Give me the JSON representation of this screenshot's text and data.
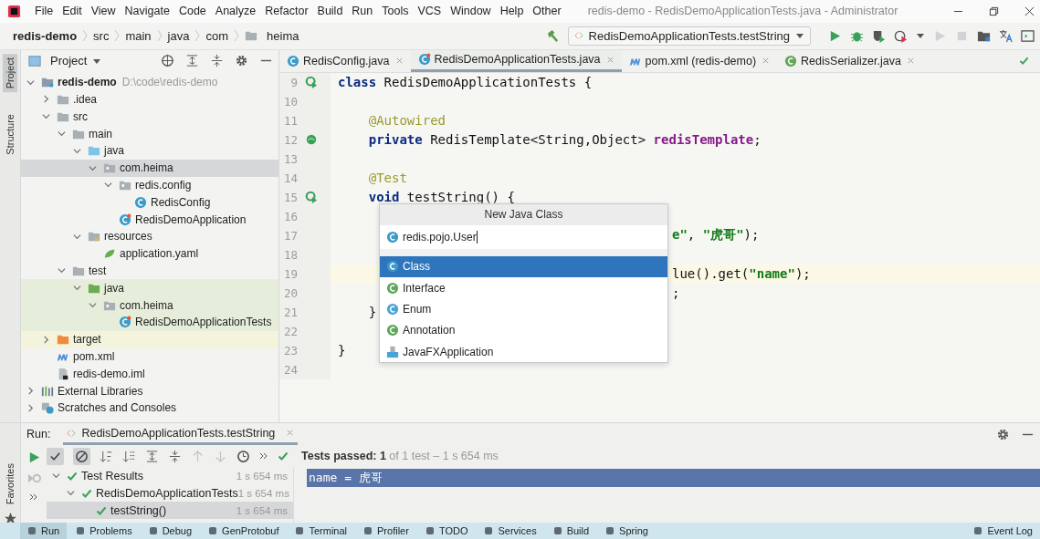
{
  "window": {
    "title": "redis-demo - RedisDemoApplicationTests.java - Administrator"
  },
  "menu": [
    "File",
    "Edit",
    "View",
    "Navigate",
    "Code",
    "Analyze",
    "Refactor",
    "Build",
    "Run",
    "Tools",
    "VCS",
    "Window",
    "Help",
    "Other"
  ],
  "breadcrumbs": [
    {
      "label": "redis-demo",
      "kind": "project"
    },
    {
      "label": "src",
      "kind": "plain"
    },
    {
      "label": "main",
      "kind": "plain"
    },
    {
      "label": "java",
      "kind": "plain"
    },
    {
      "label": "com",
      "kind": "plain"
    },
    {
      "label": "heima",
      "kind": "package"
    }
  ],
  "run_config": {
    "label": "RedisDemoApplicationTests.testString"
  },
  "side_stripe": [
    {
      "label": "Project",
      "selected": true
    },
    {
      "label": "Structure",
      "selected": false
    }
  ],
  "favorites_stripe": {
    "label": "Favorites"
  },
  "project_panel": {
    "title": "Project",
    "tree": [
      {
        "label": "redis-demo",
        "path": "D:\\code\\redis-demo",
        "kind": "module",
        "expanded": true,
        "selected": false,
        "children": [
          {
            "label": ".idea",
            "kind": "folder",
            "expanded": false,
            "selected": false
          },
          {
            "label": "src",
            "kind": "folder",
            "expanded": true,
            "selected": false,
            "children": [
              {
                "label": "main",
                "kind": "folder",
                "expanded": true,
                "selected": false,
                "children": [
                  {
                    "label": "java",
                    "kind": "source",
                    "expanded": true,
                    "selected": false,
                    "children": [
                      {
                        "label": "com.heima",
                        "kind": "package",
                        "expanded": true,
                        "selected": true,
                        "children": [
                          {
                            "label": "redis.config",
                            "kind": "package",
                            "expanded": true,
                            "selected": false,
                            "children": [
                              {
                                "label": "RedisConfig",
                                "kind": "class",
                                "selected": false
                              }
                            ]
                          },
                          {
                            "label": "RedisDemoApplication",
                            "kind": "spring-class",
                            "selected": false
                          }
                        ]
                      }
                    ]
                  },
                  {
                    "label": "resources",
                    "kind": "resources",
                    "expanded": true,
                    "selected": false,
                    "children": [
                      {
                        "label": "application.yaml",
                        "kind": "yaml",
                        "selected": false
                      }
                    ]
                  }
                ]
              },
              {
                "label": "test",
                "kind": "folder",
                "expanded": true,
                "selected": false,
                "children": [
                  {
                    "label": "java",
                    "kind": "test-source",
                    "expanded": true,
                    "selected": false,
                    "children": [
                      {
                        "label": "com.heima",
                        "kind": "package",
                        "expanded": true,
                        "selected": false,
                        "children": [
                          {
                            "label": "RedisDemoApplicationTests",
                            "kind": "test-class",
                            "selected": false
                          }
                        ]
                      }
                    ]
                  }
                ]
              }
            ]
          },
          {
            "label": "target",
            "kind": "excluded",
            "expanded": false,
            "selected": false
          },
          {
            "label": "pom.xml",
            "kind": "maven",
            "selected": false
          },
          {
            "label": "redis-demo.iml",
            "kind": "iml",
            "selected": false
          }
        ]
      },
      {
        "label": "External Libraries",
        "kind": "library",
        "expanded": false,
        "selected": false
      },
      {
        "label": "Scratches and Consoles",
        "kind": "scratches",
        "expanded": false,
        "selected": false
      }
    ]
  },
  "editor": {
    "tabs": [
      {
        "label": "RedisConfig.java",
        "kind": "class",
        "selected": false
      },
      {
        "label": "RedisDemoApplicationTests.java",
        "kind": "test-class",
        "selected": true
      },
      {
        "label": "pom.xml (redis-demo)",
        "kind": "maven",
        "selected": false
      },
      {
        "label": "RedisSerializer.java",
        "kind": "interface",
        "selected": false
      }
    ],
    "lines": [
      {
        "number": "9",
        "kind": "runnable",
        "tokens": [
          {
            "kind": "kw",
            "text": "class"
          },
          {
            "kind": "plain",
            "text": " RedisDemoApplicationTests {"
          }
        ]
      },
      {
        "number": "10"
      },
      {
        "number": "11",
        "tokens": [
          {
            "kind": "annot",
            "text": "    @Autowired"
          }
        ]
      },
      {
        "number": "12",
        "kind": "bean",
        "tokens": [
          {
            "kind": "kw",
            "text": "    private"
          },
          {
            "kind": "plain",
            "text": " RedisTemplate<String,Object> "
          },
          {
            "kind": "field",
            "text": "redisTemplate"
          },
          {
            "kind": "plain",
            "text": ";"
          }
        ]
      },
      {
        "number": "13"
      },
      {
        "number": "14",
        "tokens": [
          {
            "kind": "annot",
            "text": "    @Test"
          }
        ]
      },
      {
        "number": "15",
        "kind": "runnable",
        "tokens": [
          {
            "kind": "kw",
            "text": "    void"
          },
          {
            "kind": "plain",
            "text": " testString() {"
          }
        ]
      },
      {
        "number": "16"
      },
      {
        "number": "17",
        "tail": [
          {
            "kind": "string",
            "text": "e\""
          },
          {
            "kind": "plain",
            "text": ", "
          },
          {
            "kind": "string",
            "text": "\"虎哥\""
          },
          {
            "kind": "plain",
            "text": ");"
          }
        ]
      },
      {
        "number": "18"
      },
      {
        "number": "19",
        "current": true,
        "tail": [
          {
            "kind": "plain",
            "text": "lue().get("
          },
          {
            "kind": "string",
            "text": "\"name\""
          },
          {
            "kind": "plain",
            "text": ");"
          }
        ]
      },
      {
        "number": "20",
        "tail": [
          {
            "kind": "plain",
            "text": ";"
          }
        ]
      },
      {
        "number": "21",
        "tokens": [
          {
            "kind": "plain",
            "text": "    }"
          }
        ]
      },
      {
        "number": "22"
      },
      {
        "number": "23",
        "tokens": [
          {
            "kind": "plain",
            "text": "}"
          }
        ]
      },
      {
        "number": "24"
      }
    ],
    "popup": {
      "title": "New Java Class",
      "value": "redis.pojo.User",
      "options": [
        {
          "label": "Class",
          "kind": "class",
          "selected": true
        },
        {
          "label": "Interface",
          "kind": "interface",
          "selected": false
        },
        {
          "label": "Enum",
          "kind": "enum",
          "selected": false
        },
        {
          "label": "Annotation",
          "kind": "annotation",
          "selected": false
        },
        {
          "label": "JavaFXApplication",
          "kind": "javafx",
          "selected": false
        }
      ]
    }
  },
  "run_panel": {
    "label": "Run:",
    "tab": "RedisDemoApplicationTests.testString",
    "filters": [
      {
        "kind": "passed",
        "on": true
      },
      {
        "kind": "ignored",
        "on": true
      }
    ],
    "status": "**Tests passed: 1** of 1 test – 1 s 654 ms",
    "results": [
      {
        "label": "Test Results",
        "time": "1 s 654 ms",
        "expanded": true,
        "selected": false,
        "children": [
          {
            "label": "RedisDemoApplicationTests",
            "time": "1 s 654 ms",
            "expanded": true,
            "selected": false,
            "children": [
              {
                "label": "testString()",
                "time": "1 s 654 ms",
                "selected": true
              }
            ]
          }
        ]
      }
    ],
    "console": [
      {
        "text": "name = 虎哥",
        "selected": true
      }
    ]
  },
  "tool_windows": [
    {
      "label": "Run",
      "selected": true
    },
    {
      "label": "Problems",
      "selected": false
    },
    {
      "label": "Debug",
      "selected": false
    },
    {
      "label": "GenProtobuf",
      "selected": false
    },
    {
      "label": "Terminal",
      "selected": false
    },
    {
      "label": "Profiler",
      "selected": false
    },
    {
      "label": "TODO",
      "selected": false
    },
    {
      "label": "Services",
      "selected": false
    },
    {
      "label": "Build",
      "selected": false
    },
    {
      "label": "Spring",
      "selected": false
    },
    {
      "label": "Event Log",
      "selected": false
    }
  ]
}
